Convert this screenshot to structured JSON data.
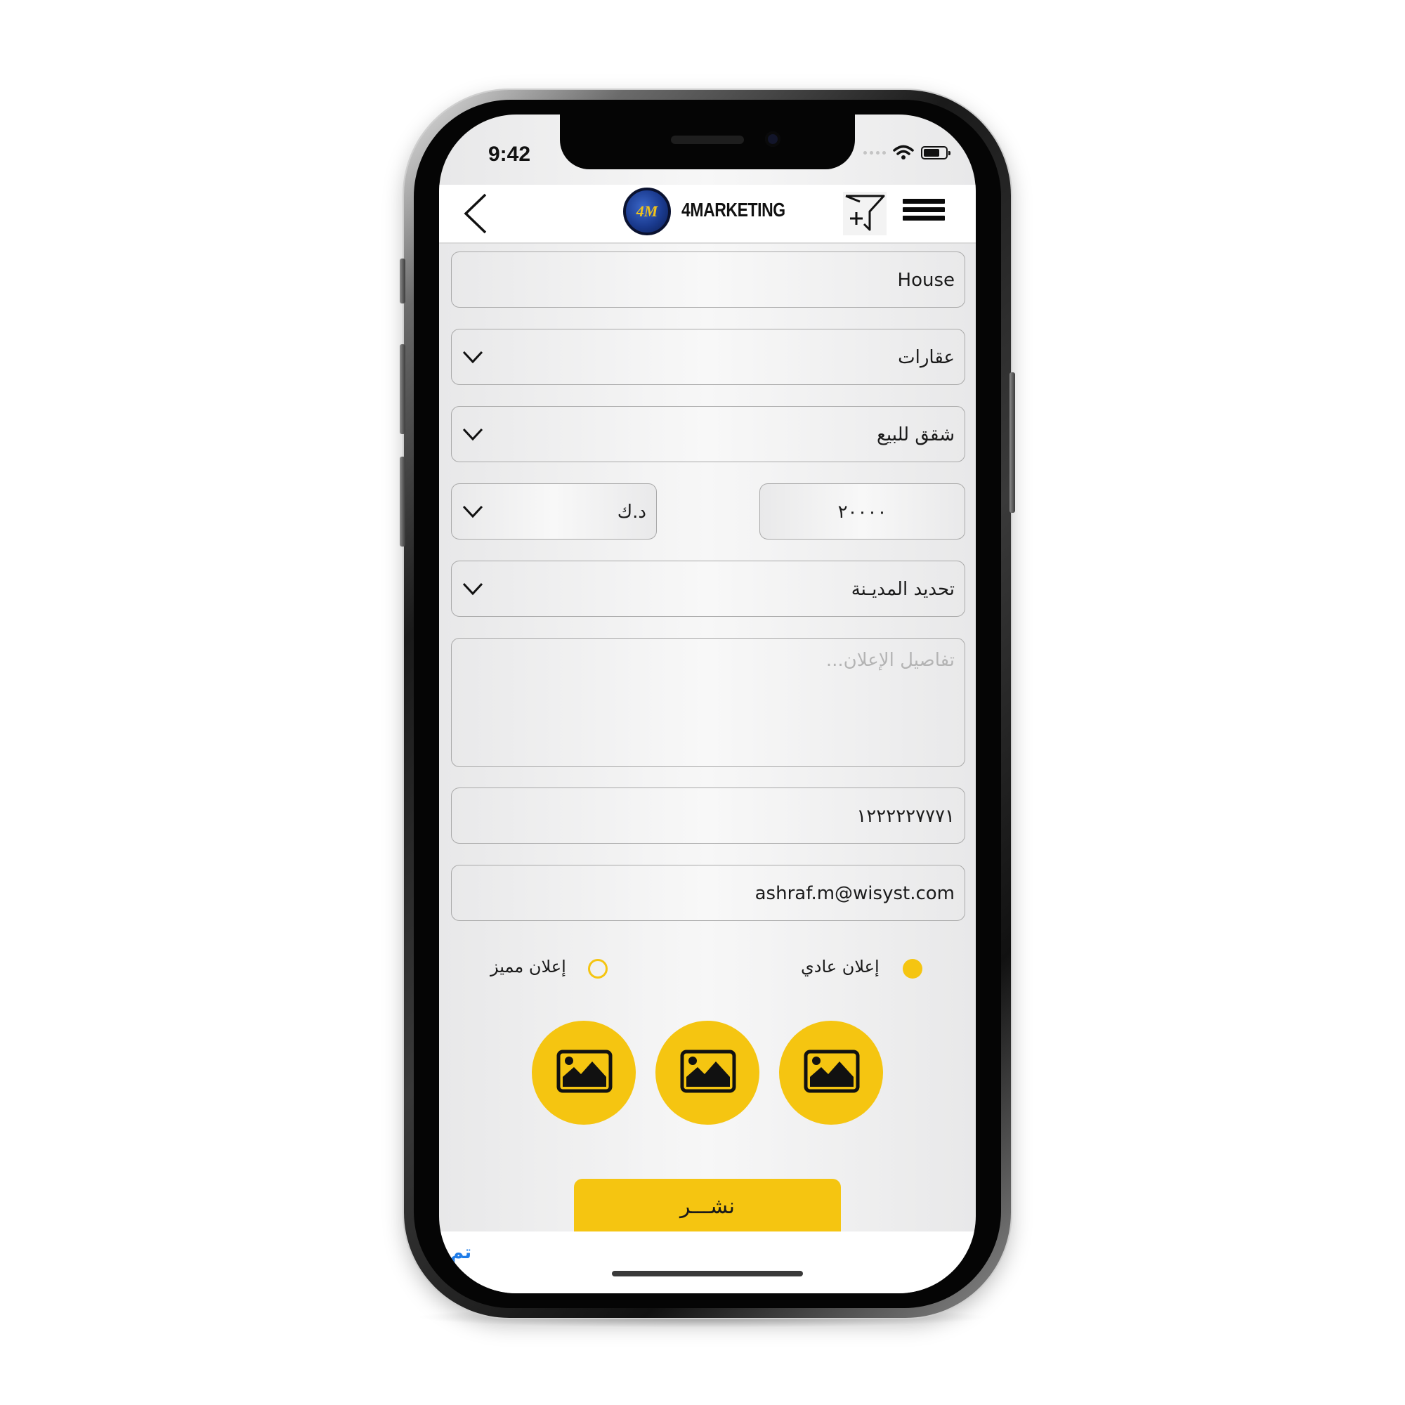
{
  "status_bar": {
    "time": "9:42"
  },
  "header": {
    "brand": "4MARKETING",
    "logo_mark": "4M"
  },
  "form": {
    "title_value": "House",
    "category_value": "عقارات",
    "subcategory_value": "شقق للبيع",
    "currency_value": "د.ك",
    "price_value": "٢٠٠٠٠",
    "city_placeholder": "تحديد المديـنة",
    "details_placeholder": "تفاصيل الإعلان...",
    "phone_value": "١٢٢٢٢٢٧٧٧١",
    "email_value": "ashraf.m@wisyst.com"
  },
  "ad_type": {
    "options": [
      {
        "label": "إعلان عادي",
        "selected": true
      },
      {
        "label": "إعلان مميز",
        "selected": false
      }
    ]
  },
  "images": {
    "slots": [
      "image-icon",
      "image-icon",
      "image-icon"
    ]
  },
  "actions": {
    "publish_label": "نشـــر",
    "done_label": "تم"
  },
  "colors": {
    "accent": "#f5c511",
    "link": "#1f7ce8",
    "brand_blue": "#1a3a8e"
  }
}
